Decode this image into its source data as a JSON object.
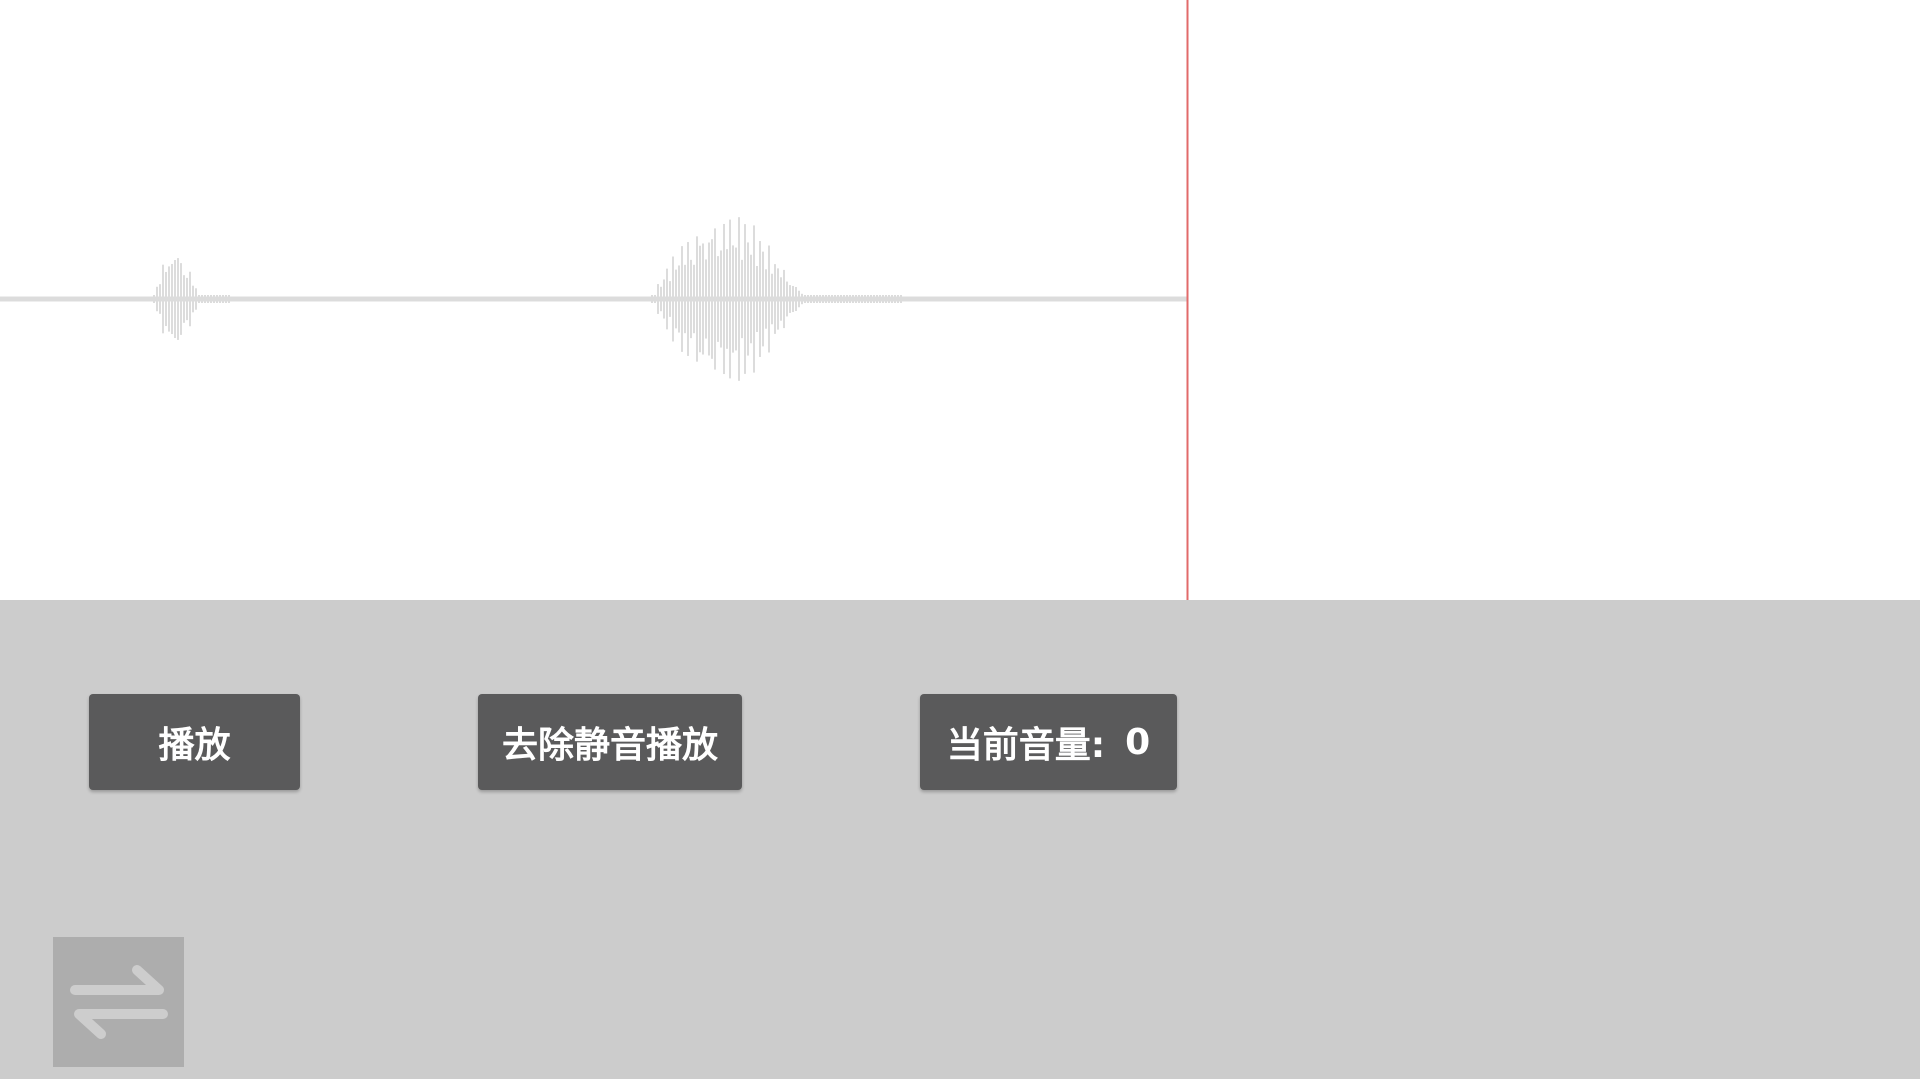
{
  "controls": {
    "play_label": "播放",
    "play_trimmed_label": "去除静音播放",
    "volume_label": "当前音量:",
    "volume_value": "0",
    "switch_icon": "swap-arrows-icon"
  },
  "waveform": {
    "wave_color": "#dcdcdc",
    "playhead_color": "#e26a6a",
    "playhead_position": 0.505
  },
  "colors": {
    "button_bg": "#5a5a5b",
    "controls_bg": "#cccccc",
    "switch_bg": "#adadad"
  }
}
